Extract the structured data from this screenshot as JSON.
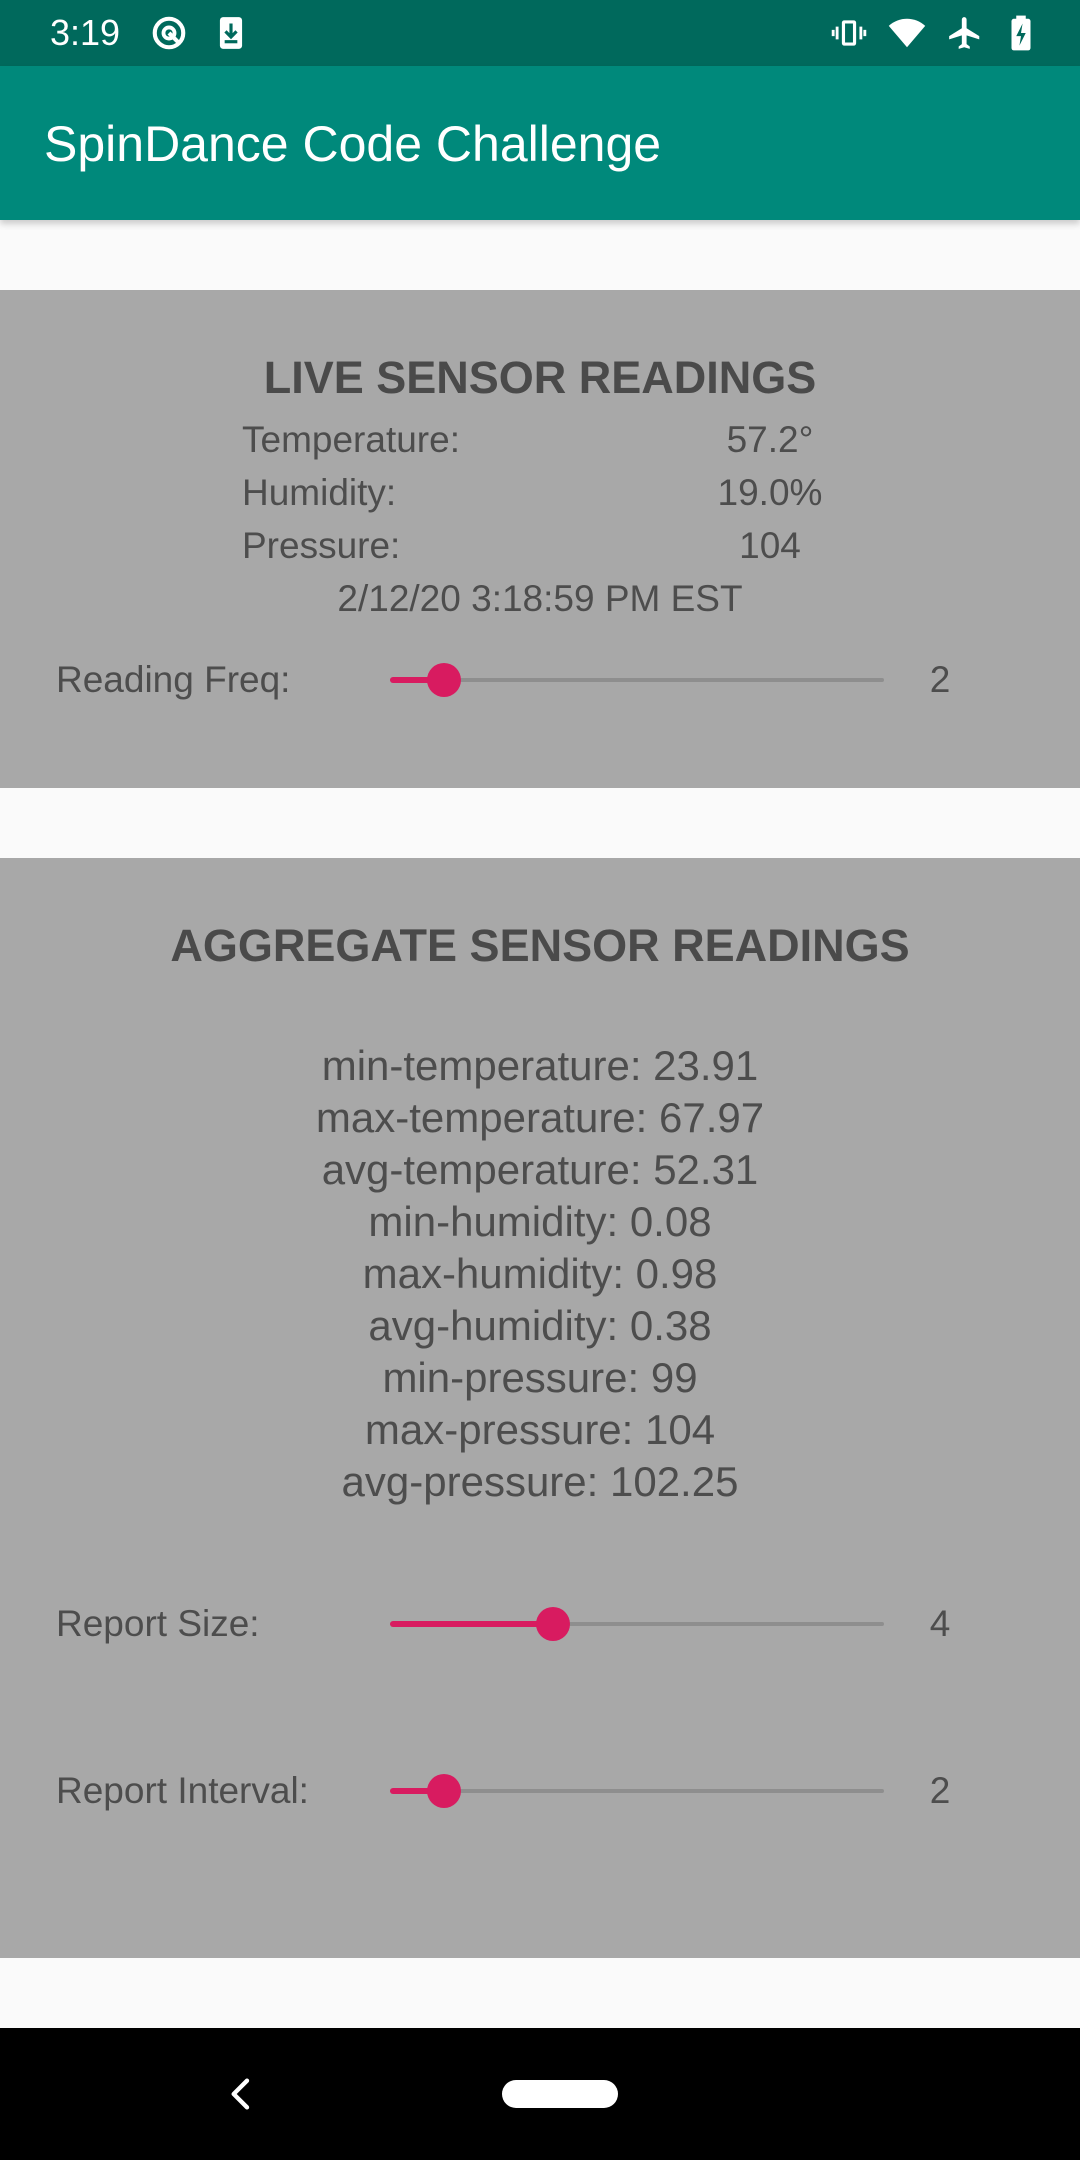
{
  "status_bar": {
    "time": "3:19",
    "left_icons": [
      "notification-at-icon",
      "download-icon"
    ],
    "right_icons": [
      "vibrate-icon",
      "wifi-icon",
      "airplane-icon",
      "battery-icon"
    ]
  },
  "app_bar": {
    "title": "SpinDance Code Challenge"
  },
  "live": {
    "title": "LIVE SENSOR READINGS",
    "rows": [
      {
        "label": "Temperature:",
        "value": "57.2°"
      },
      {
        "label": "Humidity:",
        "value": "19.0%"
      },
      {
        "label": "Pressure:",
        "value": "104"
      }
    ],
    "timestamp": "2/12/20 3:18:59 PM EST",
    "freq": {
      "label": "Reading Freq:",
      "value": "2",
      "position": 0.11
    }
  },
  "aggregate": {
    "title": "AGGREGATE SENSOR READINGS",
    "lines": [
      "min-temperature: 23.91",
      "max-temperature: 67.97",
      "avg-temperature: 52.31",
      "min-humidity: 0.08",
      "max-humidity: 0.98",
      "avg-humidity: 0.38",
      "min-pressure: 99",
      "max-pressure: 104",
      "avg-pressure: 102.25"
    ],
    "report_size": {
      "label": "Report Size:",
      "value": "4",
      "position": 0.33
    },
    "report_interval": {
      "label": "Report Interval:",
      "value": "2",
      "position": 0.11
    }
  },
  "colors": {
    "status_bar": "#00695c",
    "app_bar": "#00897b",
    "card": "#a8a8a8",
    "accent": "#d81b60",
    "text": "#4d4d4d"
  },
  "nav_bar": {
    "icons": [
      "back-icon",
      "home-pill-icon"
    ]
  }
}
